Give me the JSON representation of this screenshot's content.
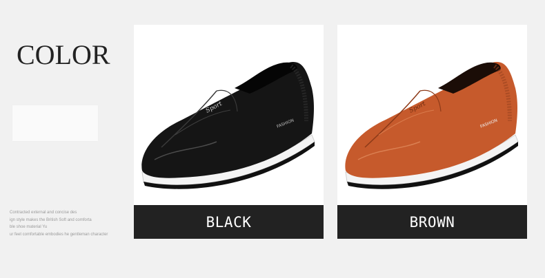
{
  "heading": "COLOR",
  "description_lines": [
    "Contracted external and concise des",
    "ign style makes the British Soft and comforta",
    "ble shoe material Yu",
    "ur feet comfortable embodies he gentleman character"
  ],
  "colors": [
    {
      "label": "BLACK",
      "shoe_color": "#151515",
      "brand_text": "Sport",
      "side_text": "FASHION"
    },
    {
      "label": "BROWN",
      "shoe_color": "#c65a2c",
      "brand_text": "Sport",
      "side_text": "FASHION"
    }
  ],
  "theme": {
    "background": "#f1f1f1",
    "label_bar": "#222222",
    "label_text": "#ffffff"
  }
}
